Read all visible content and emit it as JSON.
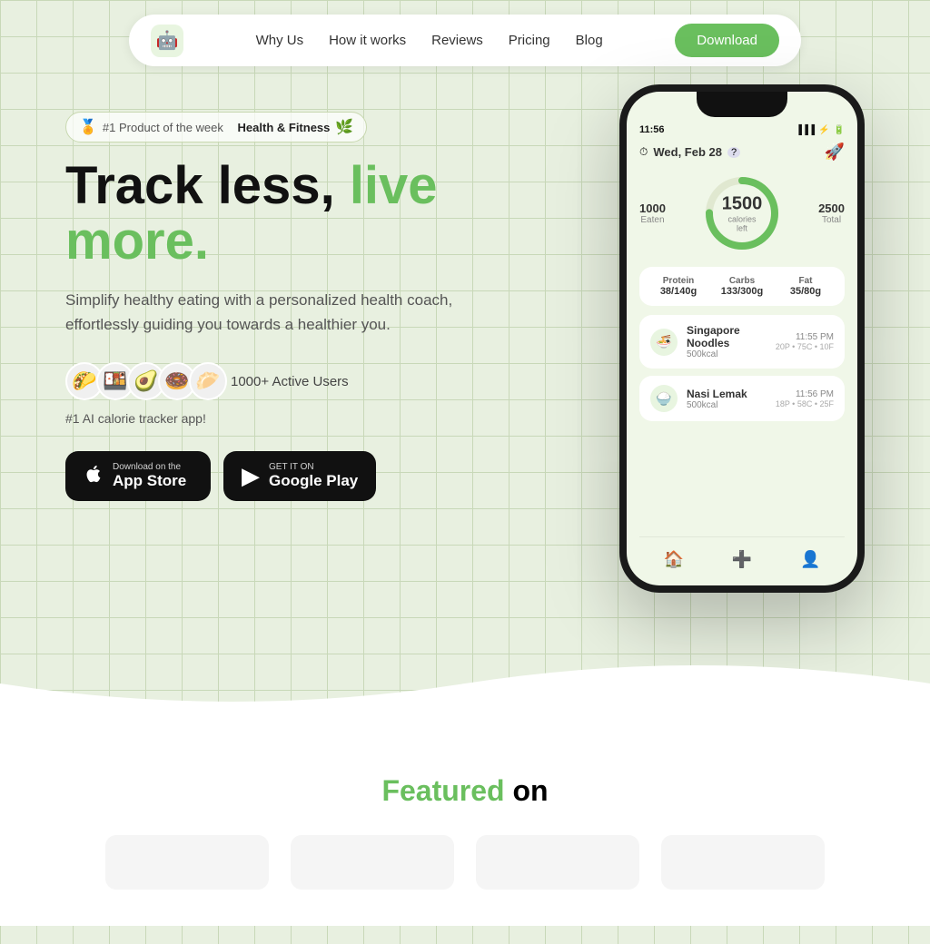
{
  "nav": {
    "logo_emoji": "🤖",
    "links": [
      "Why Us",
      "How it works",
      "Reviews",
      "Pricing",
      "Blog"
    ],
    "download_label": "Download"
  },
  "badge": {
    "rank": "#1 Product of the week",
    "category": "Health & Fitness"
  },
  "hero": {
    "title_part1": "Track less,",
    "title_part2": "live more.",
    "subtitle": "Simplify healthy eating with a personalized health coach, effortlessly guiding you towards a healthier you.",
    "active_users": "1000+ Active Users",
    "tagline": "#1 AI calorie tracker app!",
    "avatars": [
      "🌮",
      "🍱",
      "🥑",
      "🍩",
      "🥟"
    ]
  },
  "store_buttons": {
    "apple": {
      "sub": "Download on the",
      "main": "App Store"
    },
    "google": {
      "sub": "GET IT ON",
      "main": "Google Play"
    }
  },
  "phone": {
    "time": "11:56",
    "date": "Wed, Feb 28",
    "calories_eaten": "1000",
    "calories_eaten_label": "Eaten",
    "calories_left": "1500",
    "calories_left_label": "calories left",
    "calories_total": "2500",
    "calories_total_label": "Total",
    "protein": {
      "label": "Protein",
      "value": "38/140g"
    },
    "carbs": {
      "label": "Carbs",
      "value": "133/300g"
    },
    "fat": {
      "label": "Fat",
      "value": "35/80g"
    },
    "food_items": [
      {
        "name": "Singapore Noodles",
        "calories": "500kcal",
        "macros": "20P • 75C • 10F",
        "time": "11:55 PM",
        "emoji": "🍜"
      },
      {
        "name": "Nasi Lemak",
        "calories": "500kcal",
        "macros": "18P • 58C • 25F",
        "time": "11:56 PM",
        "emoji": "🍚"
      }
    ]
  },
  "featured": {
    "title_part1": "Featured",
    "title_part2": "on"
  },
  "colors": {
    "green": "#6abf5e",
    "dark": "#111111",
    "bg": "#e8f0e0"
  }
}
